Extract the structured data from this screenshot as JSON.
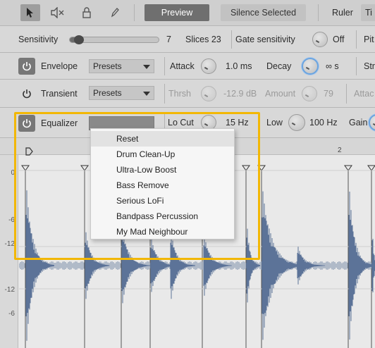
{
  "toolbar": {
    "preview_label": "Preview",
    "silence_label": "Silence Selected",
    "ruler_label": "Ruler",
    "ruler_value": "Ti"
  },
  "sensitivity": {
    "label": "Sensitivity",
    "value": "7",
    "level": 0.05,
    "slices": "Slices 23",
    "gate_label": "Gate sensitivity",
    "gate_value": "Off",
    "pitch_label": "Pit"
  },
  "envelope": {
    "label": "Envelope",
    "presets": "Presets",
    "attack_label": "Attack",
    "attack_value": "1.0 ms",
    "decay_label": "Decay",
    "decay_value": "∞ s",
    "extra_label": "Str"
  },
  "transient": {
    "label": "Transient",
    "presets": "Presets",
    "thrsh_label": "Thrsh",
    "thrsh_value": "-12.9 dB",
    "amount_label": "Amount",
    "amount_value": "79",
    "extra_label": "Attac"
  },
  "equalizer": {
    "label": "Equalizer",
    "locut_label": "Lo Cut",
    "locut_value": "15 Hz",
    "low_label": "Low",
    "low_value": "100 Hz",
    "gain_label": "Gain"
  },
  "ruler": {
    "marker_2": "2"
  },
  "axis_labels": [
    "0",
    "-6",
    "-12",
    "-12",
    "-6"
  ],
  "preset_menu": {
    "items": [
      "Reset",
      "Drum Clean-Up",
      "Ultra-Low Boost",
      "Bass Remove",
      "Serious LoFi",
      "Bandpass Percussion",
      "My Mad Neighbour"
    ]
  },
  "colors": {
    "waveform": "#5c7398",
    "highlight": "#f2b705",
    "accent_knob": "#6aa4e0"
  }
}
